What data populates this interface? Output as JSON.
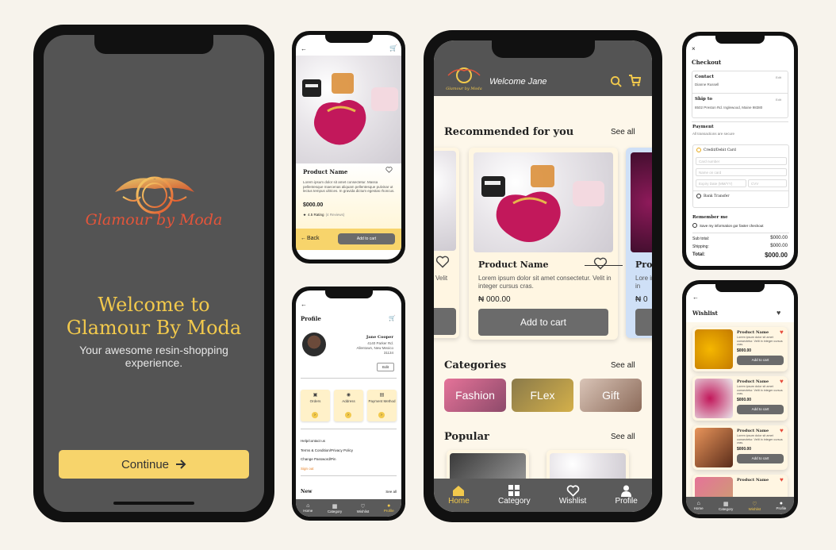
{
  "colors": {
    "accent": "#f2c94c",
    "dark": "#545454",
    "cream": "#fdf7ea",
    "heart_red": "#e74c3c"
  },
  "splash": {
    "brand": "Glamour by Moda",
    "title_line1": "Welcome to",
    "title_line2": "Glamour By Moda",
    "subtitle_line1": "Your awesome resin-shopping",
    "subtitle_line2": "experience.",
    "continue_label": "Continue"
  },
  "product_detail": {
    "name": "Product Name",
    "description": "Lorem ipsum dolor sit amet consectetur. Massa pellentesque maecenas aliquam pellentesque pulvinar ut lectus tempus ultrices. In gravida dictum egestas rhoncus.",
    "price": "$000.00",
    "rating": "4.5 Rating",
    "reviews": "(4 Reviews)",
    "back_label": "Back",
    "add_to_cart_label": "Add to cart"
  },
  "profile": {
    "title": "Profile",
    "name": "Jane Cooper",
    "address_line1": "4140 Parker Rd.",
    "address_line2": "Allentown, New Mexico",
    "address_line3": "31134",
    "edit_label": "Edit",
    "tiles": [
      {
        "label": "Orders",
        "icon": "bag-icon"
      },
      {
        "label": "Address",
        "icon": "pin-icon"
      },
      {
        "label": "Payment Method",
        "icon": "wallet-icon"
      }
    ],
    "links": [
      "Help/contact us",
      "Terms & Condition/Privacy Policy",
      "Change Password/Pin"
    ],
    "sign_out": "Sign out",
    "new_label": "New",
    "see_all": "See all",
    "nav": [
      "Home",
      "Category",
      "Wishlist",
      "Profile"
    ]
  },
  "home": {
    "welcome": "Welcome Jane",
    "logo_text": "Glamour by Moda",
    "recommended_title": "Recommended for you",
    "see_all": "See all",
    "card_name": "Product Name",
    "card_desc": "Lorem ipsum dolor sit amet consectetur. Velit in integer cursus cras.",
    "card_price": "₦ 000.00",
    "add_to_cart": "Add to cart",
    "left_card_desc": "Velit",
    "right_card_name": "Pro",
    "right_card_desc": "Lore in in",
    "right_card_price": "₦ 0",
    "categories_title": "Categories",
    "categories": [
      "Fashion",
      "FLex",
      "Gift"
    ],
    "popular_title": "Popular",
    "nav": [
      "Home",
      "Category",
      "Wishlist",
      "Profile"
    ]
  },
  "checkout": {
    "title": "Checkout",
    "contact_label": "Contact",
    "contact_value": "Dianne Russell",
    "ship_label": "Ship to",
    "ship_value": "8502 Preston Rd. Inglewood, Maine 98380",
    "edit": "Edit",
    "payment_label": "Payment",
    "payment_note": "All transactions are secure",
    "credit_label": "Credit/Debit Card",
    "card_number_ph": "Card number",
    "name_on_card_ph": "Name on card",
    "expiry_ph": "Expiry Date (MM/YY)",
    "cvv_ph": "CVV",
    "bank_label": "Bank Transfer",
    "remember_label": "Remember me",
    "remember_note": "Save my information gor faster checkout",
    "subtotal_label": "Sub total:",
    "subtotal_value": "$000.00",
    "shipping_label": "Shipping:",
    "shipping_value": "$000.00",
    "total_label": "Total:",
    "total_value": "$000.00"
  },
  "wishlist": {
    "title": "Wishlist",
    "items": [
      {
        "name": "Product Name",
        "desc": "Lorem ipsum dolor sit amet consectetur. Velit in integer cursus cras.",
        "price": "$000.00",
        "cta": "Add to cart"
      },
      {
        "name": "Product Name",
        "desc": "Lorem ipsum dolor sit amet consectetur. Velit in integer cursus cras.",
        "price": "$000.00",
        "cta": "Add to cart"
      },
      {
        "name": "Product Name",
        "desc": "Lorem ipsum dolor sit amet consectetur. Velit in integer cursus cras.",
        "price": "$000.00",
        "cta": "Add to cart"
      },
      {
        "name": "Product Name"
      }
    ],
    "nav": [
      "Home",
      "Category",
      "Wishlist",
      "Profile"
    ]
  }
}
